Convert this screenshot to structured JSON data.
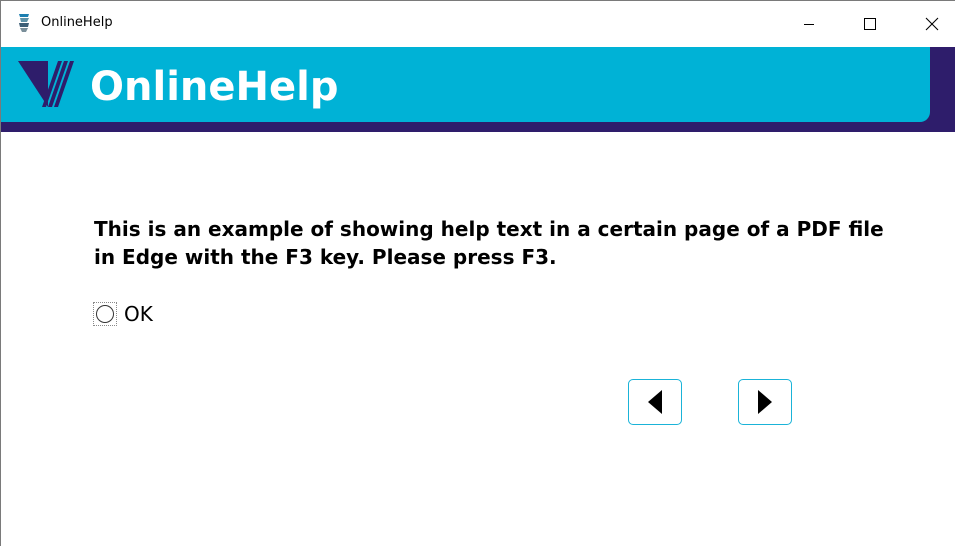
{
  "window": {
    "title": "OnlineHelp",
    "icon": "app-stack-icon",
    "controls": [
      "minimize-icon",
      "maximize-icon",
      "close-icon"
    ]
  },
  "banner": {
    "title": "OnlineHelp",
    "logo": "v-logo-icon",
    "colors": {
      "primary": "#00b2d6",
      "secondary": "#2e1d6b",
      "text": "#ffffff"
    }
  },
  "content": {
    "help_text": "This is an example of showing help text in a certain page of a PDF file in Edge with the F3 key. Please press F3.",
    "radio": {
      "label": "OK",
      "checked": false
    }
  },
  "navigation": {
    "prev_icon": "triangle-left-icon",
    "next_icon": "triangle-right-icon",
    "accent": "#1ab3d8"
  }
}
